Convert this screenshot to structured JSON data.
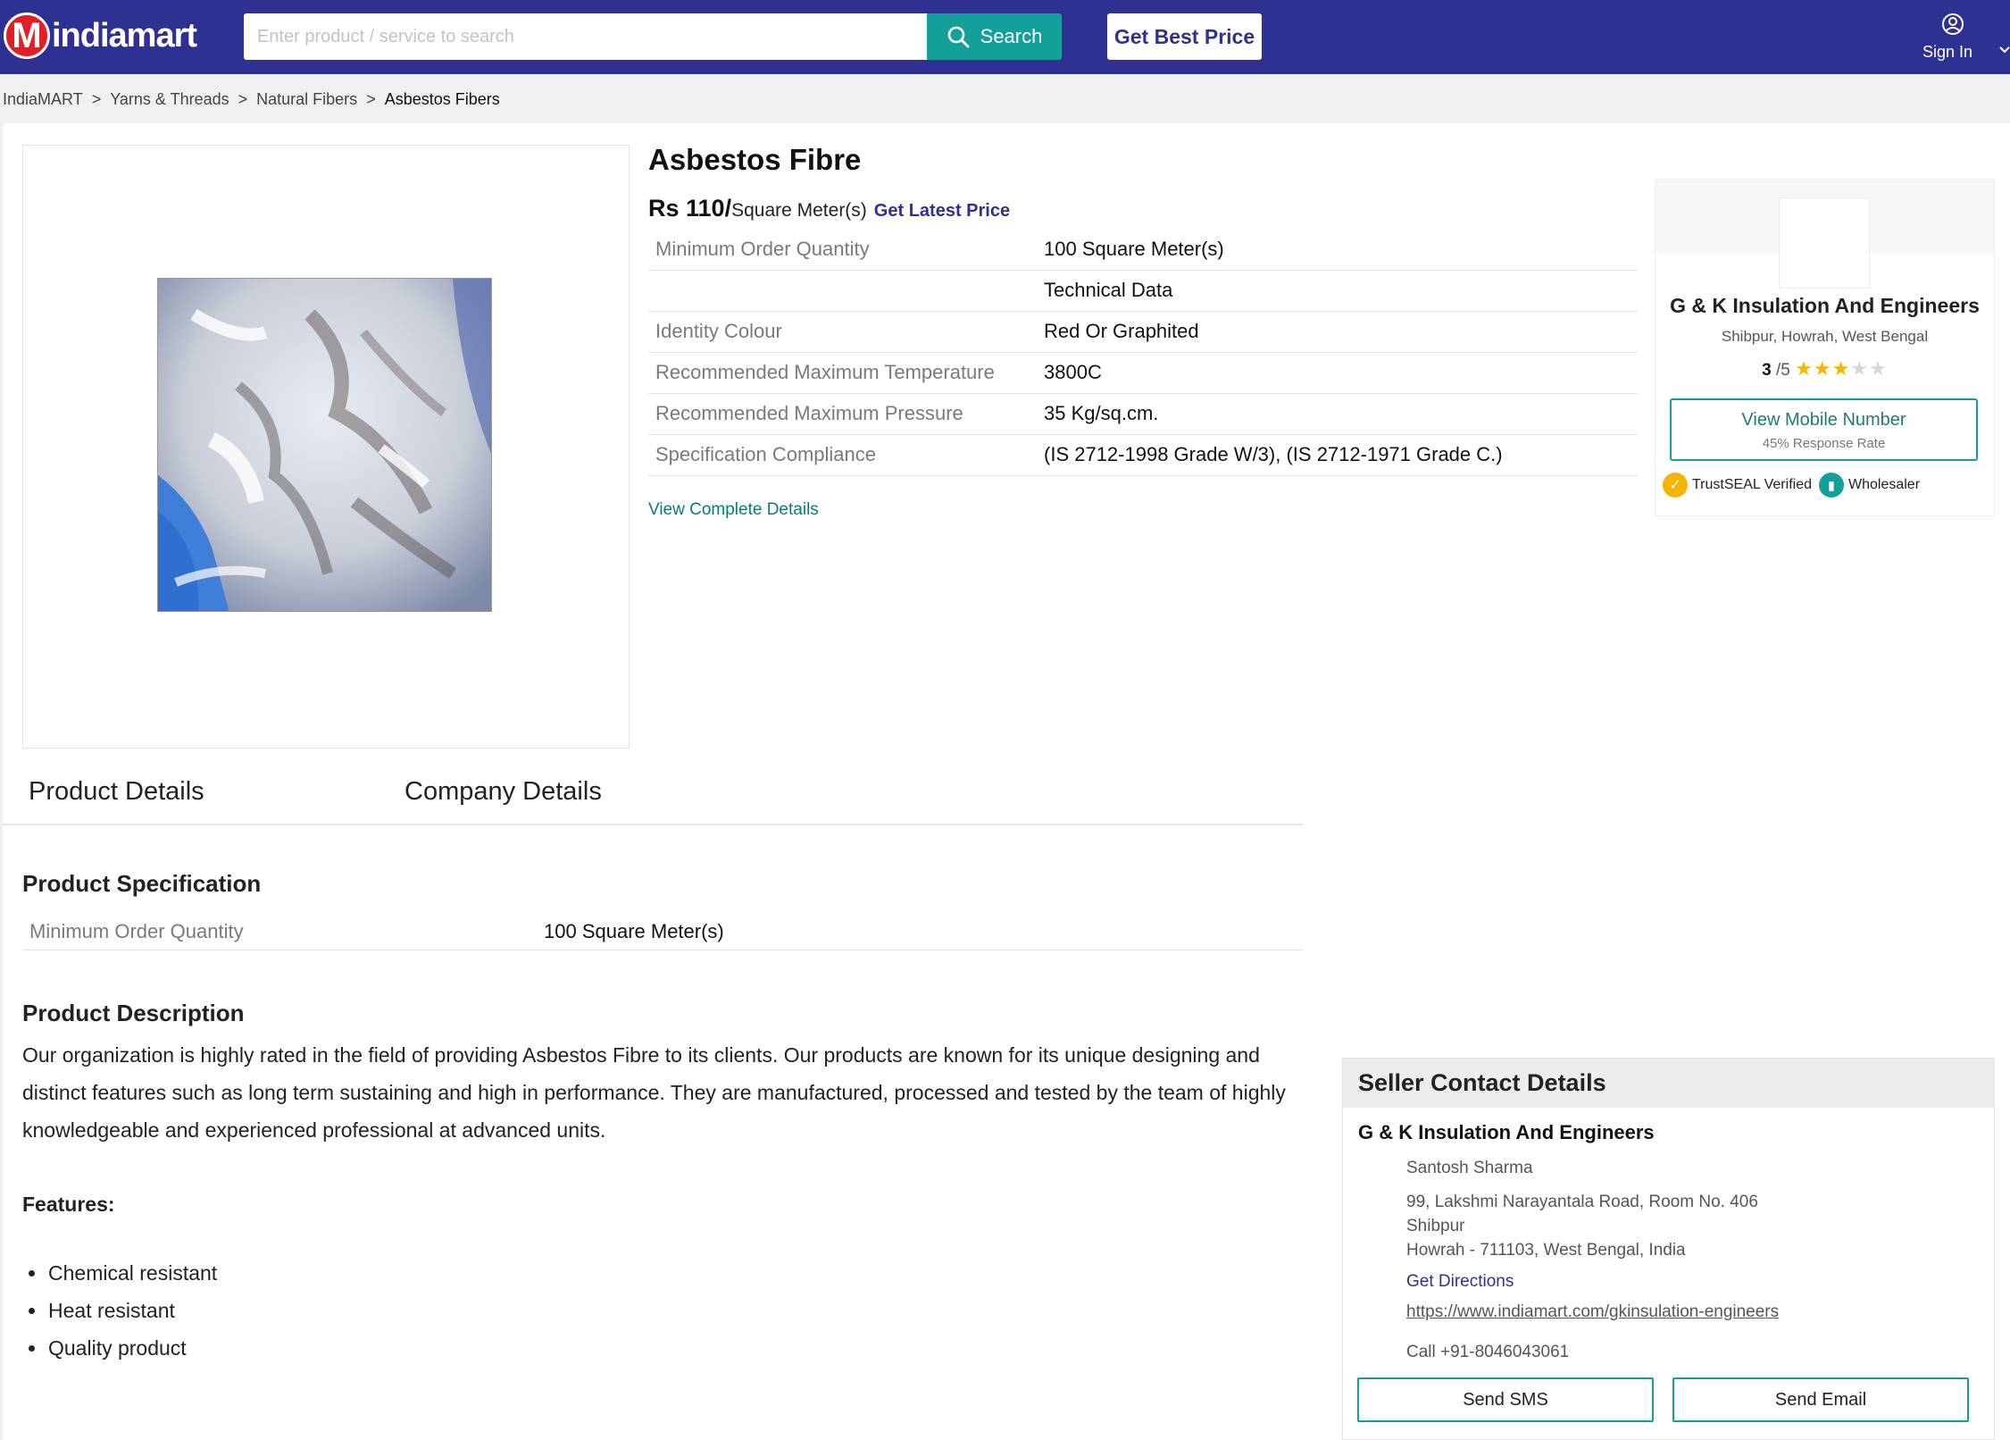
{
  "header": {
    "logo_text": "indiamart",
    "search_placeholder": "Enter product / service to search",
    "search_label": "Search",
    "best_price_label": "Get Best Price",
    "sign_in_label": "Sign In"
  },
  "breadcrumb": [
    "IndiaMART",
    "Yarns & Threads",
    "Natural Fibers",
    "Asbestos Fibers"
  ],
  "product": {
    "title": "Asbestos Fibre",
    "price": "Rs 110/",
    "price_unit": "Square Meter(s)",
    "latest_price_label": "Get Latest Price",
    "specs": [
      {
        "key": "Minimum Order Quantity",
        "value": "100 Square Meter(s)"
      },
      {
        "key": "",
        "value": "Technical Data"
      },
      {
        "key": "Identity Colour",
        "value": "Red Or Graphited"
      },
      {
        "key": "Recommended Maximum Temperature",
        "value": "3800C"
      },
      {
        "key": "Recommended Maximum Pressure",
        "value": "35 Kg/sq.cm."
      },
      {
        "key": "Specification Compliance",
        "value": "(IS 2712-1998 Grade W/3), (IS 2712-1971 Grade C.)"
      }
    ],
    "view_complete_label": "View Complete Details"
  },
  "seller_card": {
    "name": "G & K Insulation And Engineers",
    "location": "Shibpur, Howrah, West Bengal",
    "rating_value": "3",
    "rating_scale": "/5",
    "rating_stars": 3,
    "mobile_label": "View Mobile Number",
    "response_rate": "45% Response Rate",
    "badge_trust": "TrustSEAL Verified",
    "badge_wholesaler": "Wholesaler"
  },
  "tabs": [
    "Product Details",
    "Company Details"
  ],
  "spec_section": {
    "title": "Product Specification",
    "key": "Minimum Order Quantity",
    "value": "100 Square Meter(s)"
  },
  "description": {
    "title": "Product Description",
    "text": "Our organization is highly rated in the field of providing Asbestos Fibre to its clients. Our products are known for its unique designing and distinct features such as long term sustaining and high in performance. They are manufactured, processed and tested by the team of highly knowledgeable and experienced professional at advanced units.",
    "features_title": "Features:",
    "features": [
      "Chemical resistant",
      "Heat resistant",
      "Quality product"
    ]
  },
  "contact": {
    "heading": "Seller Contact Details",
    "company": "G & K Insulation And Engineers",
    "person": "Santosh Sharma",
    "address_line1": "99, Lakshmi Narayantala Road, Room No. 406",
    "address_line2": "Shibpur",
    "address_line3": "Howrah - 711103, West Bengal, India",
    "directions_label": "Get Directions",
    "url": "https://www.indiamart.com/gkinsulation-engineers",
    "call": "Call +91-8046043061",
    "sms_label": "Send SMS",
    "email_label": "Send Email"
  },
  "colors": {
    "header_bg": "#2e3192",
    "accent_teal": "#13a09b",
    "star": "#f7b500"
  }
}
